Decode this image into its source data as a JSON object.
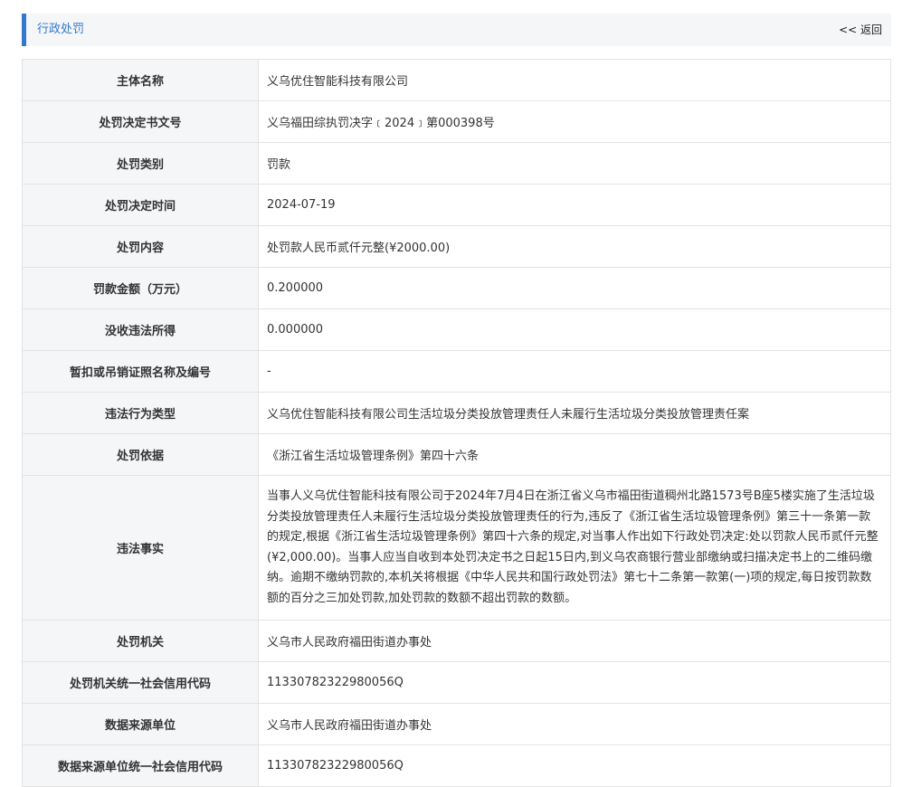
{
  "header": {
    "title": "行政处罚",
    "back_label": "<< 返回"
  },
  "rows": [
    {
      "label": "主体名称",
      "value": "义乌优住智能科技有限公司"
    },
    {
      "label": "处罚决定书文号",
      "value": "义乌福田综执罚决字﹝2024﹞第000398号"
    },
    {
      "label": "处罚类别",
      "value": "罚款"
    },
    {
      "label": "处罚决定时间",
      "value": "2024-07-19"
    },
    {
      "label": "处罚内容",
      "value": "处罚款人民币贰仟元整(¥2000.00)"
    },
    {
      "label": "罚款金额（万元）",
      "value": "0.200000"
    },
    {
      "label": "没收违法所得",
      "value": "0.000000"
    },
    {
      "label": "暂扣或吊销证照名称及编号",
      "value": "-"
    },
    {
      "label": "违法行为类型",
      "value": "义乌优住智能科技有限公司生活垃圾分类投放管理责任人未履行生活垃圾分类投放管理责任案"
    },
    {
      "label": "处罚依据",
      "value": "《浙江省生活垃圾管理条例》第四十六条"
    },
    {
      "label": "违法事实",
      "value": "当事人义乌优住智能科技有限公司于2024年7月4日在浙江省义乌市福田街道稠州北路1573号B座5楼实施了生活垃圾分类投放管理责任人未履行生活垃圾分类投放管理责任的行为,违反了《浙江省生活垃圾管理条例》第三十一条第一款的规定,根据《浙江省生活垃圾管理条例》第四十六条的规定,对当事人作出如下行政处罚决定:处以罚款人民币贰仟元整(¥2,000.00)。当事人应当自收到本处罚决定书之日起15日内,到义乌农商银行营业部缴纳或扫描决定书上的二维码缴纳。逾期不缴纳罚款的,本机关将根据《中华人民共和国行政处罚法》第七十二条第一款第(一)项的规定,每日按罚款数额的百分之三加处罚款,加处罚款的数额不超出罚款的数额。"
    },
    {
      "label": "处罚机关",
      "value": "义乌市人民政府福田街道办事处"
    },
    {
      "label": "处罚机关统一社会信用代码",
      "value": "11330782322980056Q"
    },
    {
      "label": "数据来源单位",
      "value": "义乌市人民政府福田街道办事处"
    },
    {
      "label": "数据来源单位统一社会信用代码",
      "value": "11330782322980056Q"
    }
  ]
}
